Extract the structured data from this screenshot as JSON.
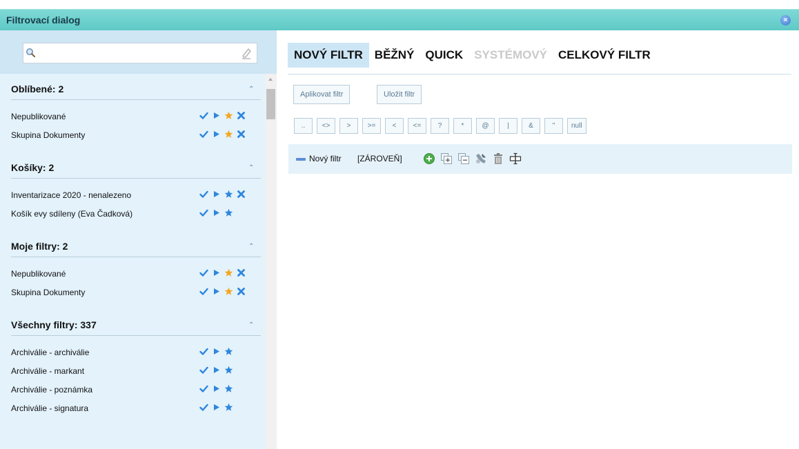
{
  "window": {
    "title": "Filtrovací dialog"
  },
  "search": {
    "placeholder": ""
  },
  "sections": [
    {
      "label": "Oblíbené: 2",
      "items": [
        {
          "name": "Nepublikované",
          "star_color": "#f5a623",
          "has_delete": true
        },
        {
          "name": "Skupina Dokumenty",
          "star_color": "#f5a623",
          "has_delete": true
        }
      ]
    },
    {
      "label": "Košíky: 2",
      "items": [
        {
          "name": "Inventarizace 2020 - nenalezeno",
          "star_color": "#2e86de",
          "has_delete": true
        },
        {
          "name": "Košík evy sdíleny (Eva Čadková)",
          "star_color": "#2e86de",
          "has_delete": false
        }
      ]
    },
    {
      "label": "Moje filtry: 2",
      "items": [
        {
          "name": "Nepublikované",
          "star_color": "#f5a623",
          "has_delete": true
        },
        {
          "name": "Skupina Dokumenty",
          "star_color": "#f5a623",
          "has_delete": true
        }
      ]
    },
    {
      "label": "Všechny filtry: 337",
      "items": [
        {
          "name": "Archiválie - archiválie",
          "star_color": "#2e86de",
          "has_delete": false
        },
        {
          "name": "Archiválie - markant",
          "star_color": "#2e86de",
          "has_delete": false
        },
        {
          "name": "Archiválie - poznámka",
          "star_color": "#2e86de",
          "has_delete": false
        },
        {
          "name": "Archiválie - signatura",
          "star_color": "#2e86de",
          "has_delete": false
        }
      ]
    }
  ],
  "tabs": [
    {
      "label": "NOVÝ FILTR",
      "state": "active"
    },
    {
      "label": "BĚŽNÝ",
      "state": "normal"
    },
    {
      "label": "QUICK",
      "state": "normal"
    },
    {
      "label": "SYSTÉMOVÝ",
      "state": "disabled"
    },
    {
      "label": "CELKOVÝ FILTR",
      "state": "normal"
    }
  ],
  "actions": {
    "apply": "Aplikovat filtr",
    "save": "Uložit filtr"
  },
  "operators": [
    "..",
    "<>",
    ">",
    ">=",
    "<",
    "<=",
    "?",
    "*",
    "@",
    "|",
    "&",
    "\"",
    "null"
  ],
  "filter": {
    "name": "Nový filtr",
    "mode": "[ZÁROVEŇ]"
  },
  "colors": {
    "check": "#2e86de",
    "play": "#2e86de",
    "delete": "#2e86de",
    "accent": "#cde6f5"
  }
}
